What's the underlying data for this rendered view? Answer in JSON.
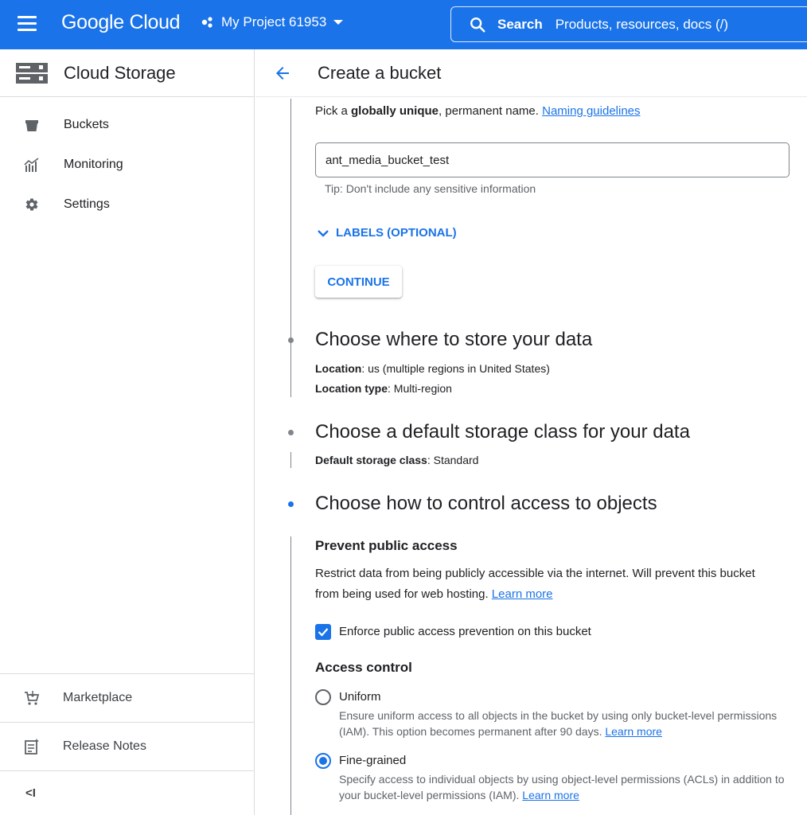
{
  "topbar": {
    "logo_text": "Google Cloud",
    "project_name": "My Project 61953",
    "search_label": "Search",
    "search_placeholder": "Products, resources, docs (/)",
    "bar_color": "#1a73e8"
  },
  "sidebar": {
    "product_name": "Cloud Storage",
    "items": [
      {
        "label": "Buckets",
        "icon": "bucket-icon"
      },
      {
        "label": "Monitoring",
        "icon": "chart-icon"
      },
      {
        "label": "Settings",
        "icon": "gear-icon"
      }
    ],
    "bottom_items": [
      {
        "label": "Marketplace",
        "icon": "cart-icon"
      },
      {
        "label": "Release Notes",
        "icon": "notes-icon"
      }
    ],
    "collapse_label": "<I"
  },
  "main": {
    "title": "Create a bucket",
    "name_step": {
      "hint_prefix": "Pick a ",
      "hint_bold": "globally unique",
      "hint_suffix": ", permanent name. ",
      "hint_link": "Naming guidelines",
      "input_value": "ant_media_bucket_test",
      "tip": "Tip: Don't include any sensitive information",
      "labels_button": "LABELS (OPTIONAL)",
      "continue_button": "CONTINUE"
    },
    "location_step": {
      "title": "Choose where to store your data",
      "location_label": "Location",
      "location_value": ": us (multiple regions in United States)",
      "type_label": "Location type",
      "type_value": ": Multi-region"
    },
    "storage_step": {
      "title": "Choose a default storage class for your data",
      "class_label": "Default storage class",
      "class_value": ": Standard"
    },
    "access_step": {
      "title": "Choose how to control access to objects",
      "prevent_title": "Prevent public access",
      "prevent_text": "Restrict data from being publicly accessible via the internet. Will prevent this bucket from being used for web hosting.",
      "prevent_link": "Learn more",
      "enforce_label": "Enforce public access prevention on this bucket",
      "enforce_checked": true,
      "access_control_title": "Access control",
      "options": [
        {
          "label": "Uniform",
          "desc": "Ensure uniform access to all objects in the bucket by using only bucket-level permissions (IAM). This option becomes permanent after 90 days.",
          "link": "Learn more",
          "checked": false
        },
        {
          "label": "Fine-grained",
          "desc": "Specify access to individual objects by using object-level permissions (ACLs) in addition to your bucket-level permissions (IAM).",
          "link": "Learn more",
          "checked": true
        }
      ]
    }
  }
}
